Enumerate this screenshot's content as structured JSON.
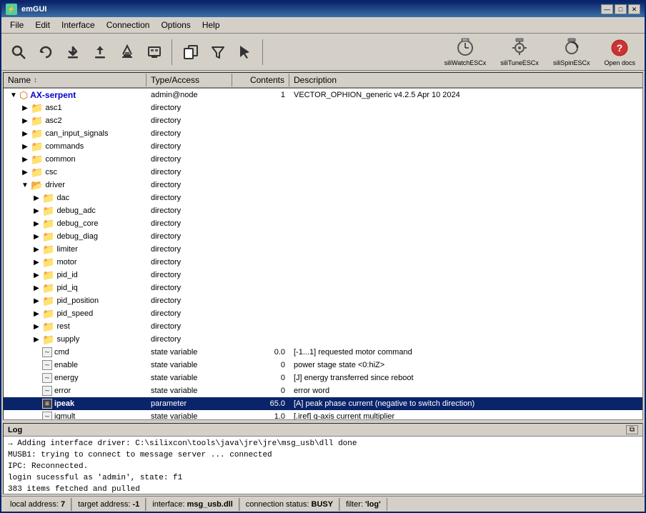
{
  "window": {
    "title": "emGUI",
    "icon": "⚡"
  },
  "titlebar": {
    "minimize_label": "—",
    "maximize_label": "□",
    "close_label": "✕"
  },
  "menu": {
    "items": [
      "File",
      "Edit",
      "Interface",
      "Connection",
      "Options",
      "Help"
    ]
  },
  "toolbar": {
    "buttons": [
      {
        "name": "search-btn",
        "icon": "🔍",
        "tooltip": "Search"
      },
      {
        "name": "refresh-btn",
        "icon": "↺",
        "tooltip": "Refresh"
      },
      {
        "name": "download-btn",
        "icon": "⬇",
        "tooltip": "Download"
      },
      {
        "name": "upload-btn",
        "icon": "⬆",
        "tooltip": "Upload"
      },
      {
        "name": "flash-btn",
        "icon": "⏏",
        "tooltip": "Flash"
      },
      {
        "name": "device-btn",
        "icon": "🖥",
        "tooltip": "Device"
      },
      {
        "name": "copy-btn",
        "icon": "📋",
        "tooltip": "Copy"
      },
      {
        "name": "filter-btn",
        "icon": "⊽",
        "tooltip": "Filter"
      },
      {
        "name": "cursor-btn",
        "icon": "☛",
        "tooltip": "Cursor"
      }
    ],
    "ext_buttons": [
      {
        "name": "siliwatch",
        "label": "siliWatchESCx",
        "icon": "⚙"
      },
      {
        "name": "silitune",
        "label": "siliTuneESCx",
        "icon": "⚙"
      },
      {
        "name": "silispin",
        "label": "siliSpinESCx",
        "icon": "⚙"
      },
      {
        "name": "opendocs",
        "label": "Open docs",
        "icon": "📖"
      }
    ]
  },
  "table": {
    "headers": [
      "Name",
      "Type/Access",
      "Contents",
      "Description"
    ],
    "sort_arrow": "↕"
  },
  "tree": [
    {
      "id": "ax-serpent",
      "level": 0,
      "expanded": true,
      "type": "node",
      "name": "AX-serpent",
      "access": "admin@node",
      "contents": "1",
      "desc": "VECTOR_OPHION_generic v4.2.5 Apr 10 2024"
    },
    {
      "id": "asc1",
      "level": 1,
      "expanded": false,
      "type": "folder",
      "name": "asc1",
      "access": "directory",
      "contents": "",
      "desc": ""
    },
    {
      "id": "asc2",
      "level": 1,
      "expanded": false,
      "type": "folder",
      "name": "asc2",
      "access": "directory",
      "contents": "",
      "desc": ""
    },
    {
      "id": "can_input_signals",
      "level": 1,
      "expanded": false,
      "type": "folder",
      "name": "can_input_signals",
      "access": "directory",
      "contents": "",
      "desc": ""
    },
    {
      "id": "commands",
      "level": 1,
      "expanded": false,
      "type": "folder",
      "name": "commands",
      "access": "directory",
      "contents": "",
      "desc": ""
    },
    {
      "id": "common",
      "level": 1,
      "expanded": false,
      "type": "folder",
      "name": "common",
      "access": "directory",
      "contents": "",
      "desc": ""
    },
    {
      "id": "csc",
      "level": 1,
      "expanded": false,
      "type": "folder",
      "name": "csc",
      "access": "directory",
      "contents": "",
      "desc": ""
    },
    {
      "id": "driver",
      "level": 1,
      "expanded": true,
      "type": "folder",
      "name": "driver",
      "access": "directory",
      "contents": "",
      "desc": ""
    },
    {
      "id": "dac",
      "level": 2,
      "expanded": false,
      "type": "folder",
      "name": "dac",
      "access": "directory",
      "contents": "",
      "desc": ""
    },
    {
      "id": "debug_adc",
      "level": 2,
      "expanded": false,
      "type": "folder",
      "name": "debug_adc",
      "access": "directory",
      "contents": "",
      "desc": ""
    },
    {
      "id": "debug_core",
      "level": 2,
      "expanded": false,
      "type": "folder",
      "name": "debug_core",
      "access": "directory",
      "contents": "",
      "desc": ""
    },
    {
      "id": "debug_diag",
      "level": 2,
      "expanded": false,
      "type": "folder",
      "name": "debug_diag",
      "access": "directory",
      "contents": "",
      "desc": ""
    },
    {
      "id": "limiter",
      "level": 2,
      "expanded": false,
      "type": "folder",
      "name": "limiter",
      "access": "directory",
      "contents": "",
      "desc": ""
    },
    {
      "id": "motor",
      "level": 2,
      "expanded": false,
      "type": "folder",
      "name": "motor",
      "access": "directory",
      "contents": "",
      "desc": ""
    },
    {
      "id": "pid_id",
      "level": 2,
      "expanded": false,
      "type": "folder",
      "name": "pid_id",
      "access": "directory",
      "contents": "",
      "desc": ""
    },
    {
      "id": "pid_iq",
      "level": 2,
      "expanded": false,
      "type": "folder",
      "name": "pid_iq",
      "access": "directory",
      "contents": "",
      "desc": ""
    },
    {
      "id": "pid_position",
      "level": 2,
      "expanded": false,
      "type": "folder",
      "name": "pid_position",
      "access": "directory",
      "contents": "",
      "desc": ""
    },
    {
      "id": "pid_speed",
      "level": 2,
      "expanded": false,
      "type": "folder",
      "name": "pid_speed",
      "access": "directory",
      "contents": "",
      "desc": ""
    },
    {
      "id": "rest",
      "level": 2,
      "expanded": false,
      "type": "folder",
      "name": "rest",
      "access": "directory",
      "contents": "",
      "desc": ""
    },
    {
      "id": "supply",
      "level": 2,
      "expanded": false,
      "type": "folder",
      "name": "supply",
      "access": "directory",
      "contents": "",
      "desc": ""
    },
    {
      "id": "cmd",
      "level": 2,
      "expanded": false,
      "type": "statevar",
      "name": "cmd",
      "access": "state variable",
      "contents": "0.0",
      "desc": "[-1...1] requested motor command"
    },
    {
      "id": "enable",
      "level": 2,
      "expanded": false,
      "type": "statevar",
      "name": "enable",
      "access": "state variable",
      "contents": "0",
      "desc": "power stage state <0:hiZ>"
    },
    {
      "id": "energy",
      "level": 2,
      "expanded": false,
      "type": "statevar",
      "name": "energy",
      "access": "state variable",
      "contents": "0",
      "desc": "[J] energy transferred since reboot"
    },
    {
      "id": "error",
      "level": 2,
      "expanded": false,
      "type": "statevar",
      "name": "error",
      "access": "state variable",
      "contents": "0",
      "desc": "error word"
    },
    {
      "id": "ipeak",
      "level": 2,
      "expanded": false,
      "type": "param",
      "name": "ipeak",
      "access": "parameter",
      "contents": "65.0",
      "desc": "[A] peak phase current (negative to switch direction)",
      "selected": true
    },
    {
      "id": "iqmult",
      "level": 2,
      "expanded": false,
      "type": "statevar",
      "name": "iqmult",
      "access": "state variable",
      "contents": "1.0",
      "desc": "[.iref] q-axis current multiplier"
    }
  ],
  "log": {
    "title": "Log",
    "lines": [
      "→ Adding interface driver: C:\\silixcon\\tools\\java\\jre\\jre\\msg_usb\\dll done",
      "MUSB1: trying to connect to message server ... connected",
      "IPC: Reconnected.",
      "login sucessful as 'admin', state: f1",
      "383 items fetched and pulled"
    ]
  },
  "statusbar": {
    "local_label": "local address:",
    "local_value": "7",
    "target_label": "target address:",
    "target_value": "-1",
    "interface_label": "interface:",
    "interface_value": "msg_usb.dll",
    "connection_label": "connection status:",
    "connection_value": "BUSY",
    "filter_label": "filter:",
    "filter_value": "'log'"
  },
  "icons": {
    "search": "🔍",
    "refresh": "⟳",
    "download": "↓",
    "upload": "↑",
    "flash": "⏏",
    "device": "🖥",
    "copy": "⧉",
    "filter": "▽",
    "cursor": "↖",
    "gear": "⚙",
    "book": "📖",
    "folder_closed": "📁",
    "folder_open": "📂",
    "state_var": "▣",
    "param": "≡",
    "expander_open": "▼",
    "expander_closed": "▶",
    "expander_none": " "
  }
}
